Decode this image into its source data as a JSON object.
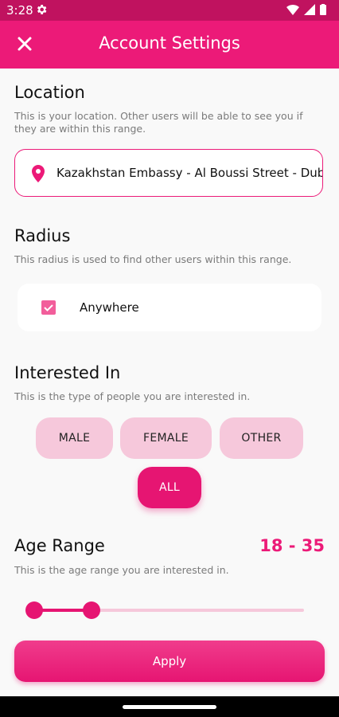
{
  "status_bar": {
    "time": "3:28"
  },
  "app_bar": {
    "title": "Account Settings"
  },
  "location": {
    "title": "Location",
    "description": "This is your location. Other users will be able to see you if they are within this range.",
    "value": "Kazakhstan Embassy - Al Boussi Street - Dubai"
  },
  "radius": {
    "title": "Radius",
    "description": "This radius is used to find other users within this range.",
    "option_label": "Anywhere",
    "checked": true
  },
  "interested": {
    "title": "Interested In",
    "description": "This is the type of people you are interested in.",
    "options": [
      "MALE",
      "FEMALE",
      "OTHER",
      "ALL"
    ],
    "selected": "ALL"
  },
  "age": {
    "title": "Age Range",
    "description": "This is the age range you are interested in.",
    "range_text": "18 - 35",
    "min": 18,
    "max": 35
  },
  "apply_label": "Apply",
  "colors": {
    "accent": "#ec1a78",
    "chip": "#f6c8db",
    "status_bar": "#c0125f"
  }
}
